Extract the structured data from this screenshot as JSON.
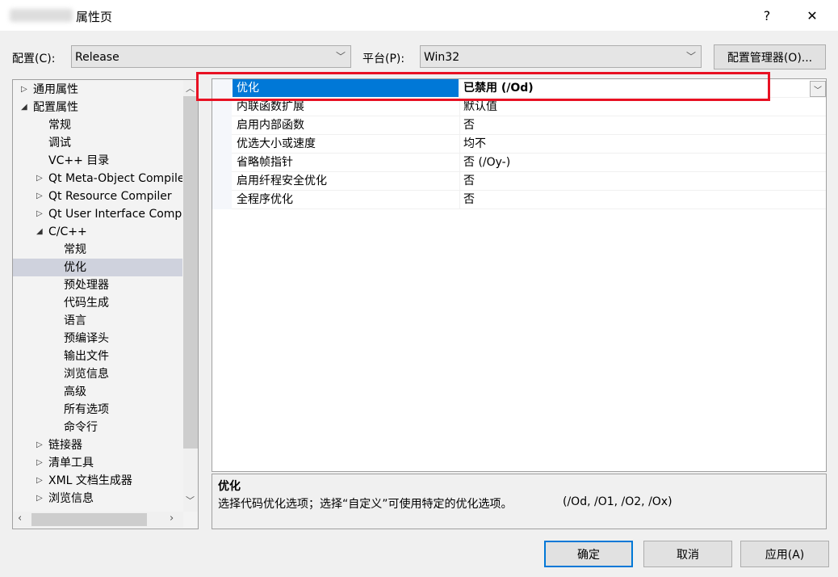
{
  "window": {
    "title": "属性页",
    "help": "?",
    "close": "✕"
  },
  "config": {
    "label": "配置(C):",
    "value": "Release",
    "platform_label": "平台(P):",
    "platform_value": "Win32",
    "manager_button": "配置管理器(O)..."
  },
  "tree": {
    "items": [
      {
        "label": "通用属性",
        "level": 0,
        "state": "collapsed"
      },
      {
        "label": "配置属性",
        "level": 0,
        "state": "expanded"
      },
      {
        "label": "常规",
        "level": 1,
        "state": "leaf"
      },
      {
        "label": "调试",
        "level": 1,
        "state": "leaf"
      },
      {
        "label": "VC++ 目录",
        "level": 1,
        "state": "leaf"
      },
      {
        "label": "Qt Meta-Object Compiler",
        "level": 1,
        "state": "collapsed"
      },
      {
        "label": "Qt Resource Compiler",
        "level": 1,
        "state": "collapsed"
      },
      {
        "label": "Qt User Interface Compiler",
        "level": 1,
        "state": "collapsed"
      },
      {
        "label": "C/C++",
        "level": 1,
        "state": "expanded"
      },
      {
        "label": "常规",
        "level": 2,
        "state": "leaf"
      },
      {
        "label": "优化",
        "level": 2,
        "state": "leaf",
        "selected": true
      },
      {
        "label": "预处理器",
        "level": 2,
        "state": "leaf"
      },
      {
        "label": "代码生成",
        "level": 2,
        "state": "leaf"
      },
      {
        "label": "语言",
        "level": 2,
        "state": "leaf"
      },
      {
        "label": "预编译头",
        "level": 2,
        "state": "leaf"
      },
      {
        "label": "输出文件",
        "level": 2,
        "state": "leaf"
      },
      {
        "label": "浏览信息",
        "level": 2,
        "state": "leaf"
      },
      {
        "label": "高级",
        "level": 2,
        "state": "leaf"
      },
      {
        "label": "所有选项",
        "level": 2,
        "state": "leaf"
      },
      {
        "label": "命令行",
        "level": 2,
        "state": "leaf"
      },
      {
        "label": "链接器",
        "level": 1,
        "state": "collapsed"
      },
      {
        "label": "清单工具",
        "level": 1,
        "state": "collapsed"
      },
      {
        "label": "XML 文档生成器",
        "level": 1,
        "state": "collapsed"
      },
      {
        "label": "浏览信息",
        "level": 1,
        "state": "collapsed"
      }
    ]
  },
  "properties": [
    {
      "name": "优化",
      "value": "已禁用 (/Od)",
      "selected": true
    },
    {
      "name": "内联函数扩展",
      "value": "默认值"
    },
    {
      "name": "启用内部函数",
      "value": "否"
    },
    {
      "name": "优选大小或速度",
      "value": "均不"
    },
    {
      "name": "省略帧指针",
      "value": "否 (/Oy-)"
    },
    {
      "name": "启用纤程安全优化",
      "value": "否"
    },
    {
      "name": "全程序优化",
      "value": "否"
    }
  ],
  "description": {
    "title": "优化",
    "text": "选择代码优化选项；选择“自定义”可使用特定的优化选项。",
    "flags": "(/Od, /O1, /O2, /Ox)"
  },
  "buttons": {
    "ok": "确定",
    "cancel": "取消",
    "apply": "应用(A)"
  },
  "colors": {
    "selection": "#0078d7",
    "highlight_box": "#e81123"
  }
}
